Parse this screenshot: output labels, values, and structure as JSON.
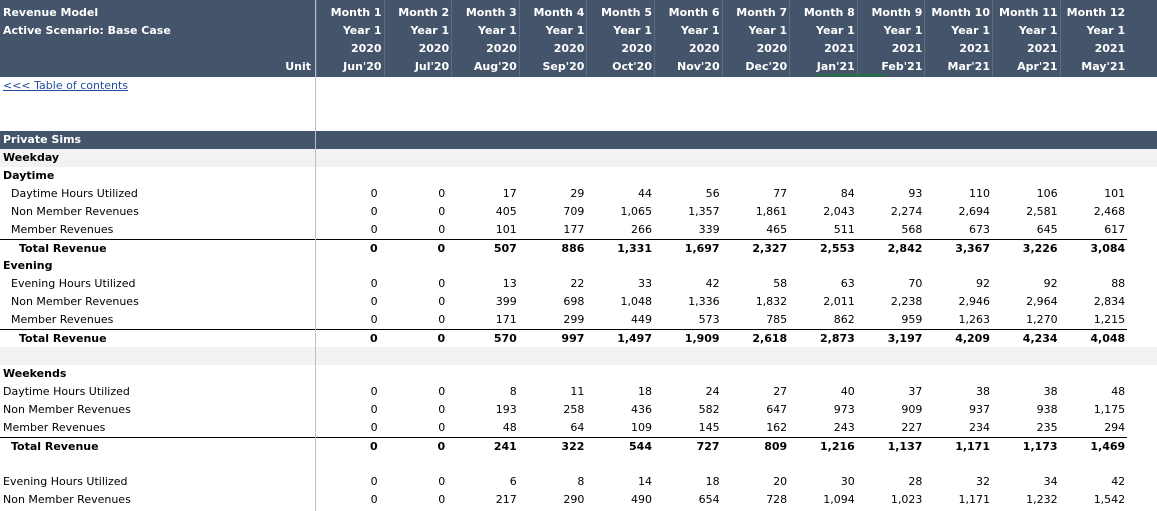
{
  "header": {
    "title_line1": "Revenue Model",
    "title_line2": "Active Scenario: Base Case",
    "unit_label": "Unit",
    "months": [
      "Month 1",
      "Month 2",
      "Month 3",
      "Month 4",
      "Month 5",
      "Month 6",
      "Month 7",
      "Month 8",
      "Month 9",
      "Month 10",
      "Month 11",
      "Month 12"
    ],
    "years": [
      "Year 1",
      "Year 1",
      "Year 1",
      "Year 1",
      "Year 1",
      "Year 1",
      "Year 1",
      "Year 1",
      "Year 1",
      "Year 1",
      "Year 1",
      "Year 1"
    ],
    "calendar_years": [
      "2020",
      "2020",
      "2020",
      "2020",
      "2020",
      "2020",
      "2020",
      "2021",
      "2021",
      "2021",
      "2021",
      "2021"
    ],
    "periods": [
      "Jun'20",
      "Jul'20",
      "Aug'20",
      "Sep'20",
      "Oct'20",
      "Nov'20",
      "Dec'20",
      "Jan'21",
      "Feb'21",
      "Mar'21",
      "Apr'21",
      "May'21"
    ]
  },
  "toc_link": "<<< Table of contents",
  "rows": [
    {
      "type": "section",
      "label": "Private Sims"
    },
    {
      "type": "group",
      "label": "Weekday"
    },
    {
      "type": "subgroup",
      "label": "Daytime"
    },
    {
      "type": "data",
      "indent": 1,
      "label": "Daytime Hours Utilized",
      "values": [
        "0",
        "0",
        "17",
        "29",
        "44",
        "56",
        "77",
        "84",
        "93",
        "110",
        "106",
        "101"
      ]
    },
    {
      "type": "data",
      "indent": 1,
      "label": "Non Member Revenues",
      "values": [
        "0",
        "0",
        "405",
        "709",
        "1,065",
        "1,357",
        "1,861",
        "2,043",
        "2,274",
        "2,694",
        "2,581",
        "2,468"
      ]
    },
    {
      "type": "data",
      "indent": 1,
      "label": "Member Revenues",
      "values": [
        "0",
        "0",
        "101",
        "177",
        "266",
        "339",
        "465",
        "511",
        "568",
        "673",
        "645",
        "617"
      ]
    },
    {
      "type": "total",
      "indent": 2,
      "label": "Total Revenue",
      "values": [
        "0",
        "0",
        "507",
        "886",
        "1,331",
        "1,697",
        "2,327",
        "2,553",
        "2,842",
        "3,367",
        "3,226",
        "3,084"
      ]
    },
    {
      "type": "subgroup",
      "label": "Evening"
    },
    {
      "type": "data",
      "indent": 1,
      "label": "Evening Hours Utilized",
      "values": [
        "0",
        "0",
        "13",
        "22",
        "33",
        "42",
        "58",
        "63",
        "70",
        "92",
        "92",
        "88"
      ]
    },
    {
      "type": "data",
      "indent": 1,
      "label": "Non Member Revenues",
      "values": [
        "0",
        "0",
        "399",
        "698",
        "1,048",
        "1,336",
        "1,832",
        "2,011",
        "2,238",
        "2,946",
        "2,964",
        "2,834"
      ]
    },
    {
      "type": "data",
      "indent": 1,
      "label": "Member Revenues",
      "values": [
        "0",
        "0",
        "171",
        "299",
        "449",
        "573",
        "785",
        "862",
        "959",
        "1,263",
        "1,270",
        "1,215"
      ]
    },
    {
      "type": "total",
      "indent": 2,
      "label": "Total Revenue",
      "values": [
        "0",
        "0",
        "570",
        "997",
        "1,497",
        "1,909",
        "2,618",
        "2,873",
        "3,197",
        "4,209",
        "4,234",
        "4,048"
      ]
    },
    {
      "type": "blank-light"
    },
    {
      "type": "subgroup",
      "label": "Weekends"
    },
    {
      "type": "data",
      "indent": 0,
      "label": "Daytime Hours Utilized",
      "values": [
        "0",
        "0",
        "8",
        "11",
        "18",
        "24",
        "27",
        "40",
        "37",
        "38",
        "38",
        "48"
      ]
    },
    {
      "type": "data",
      "indent": 0,
      "label": "Non Member Revenues",
      "values": [
        "0",
        "0",
        "193",
        "258",
        "436",
        "582",
        "647",
        "973",
        "909",
        "937",
        "938",
        "1,175"
      ]
    },
    {
      "type": "data",
      "indent": 0,
      "label": "Member Revenues",
      "values": [
        "0",
        "0",
        "48",
        "64",
        "109",
        "145",
        "162",
        "243",
        "227",
        "234",
        "235",
        "294"
      ]
    },
    {
      "type": "total",
      "indent": 1,
      "label": "Total Revenue",
      "values": [
        "0",
        "0",
        "241",
        "322",
        "544",
        "727",
        "809",
        "1,216",
        "1,137",
        "1,171",
        "1,173",
        "1,469"
      ]
    },
    {
      "type": "blank"
    },
    {
      "type": "data",
      "indent": 0,
      "label": "Evening Hours Utilized",
      "values": [
        "0",
        "0",
        "6",
        "8",
        "14",
        "18",
        "20",
        "30",
        "28",
        "32",
        "34",
        "42"
      ]
    },
    {
      "type": "data",
      "indent": 0,
      "label": "Non Member Revenues",
      "values": [
        "0",
        "0",
        "217",
        "290",
        "490",
        "654",
        "728",
        "1,094",
        "1,023",
        "1,171",
        "1,232",
        "1,542"
      ]
    }
  ]
}
